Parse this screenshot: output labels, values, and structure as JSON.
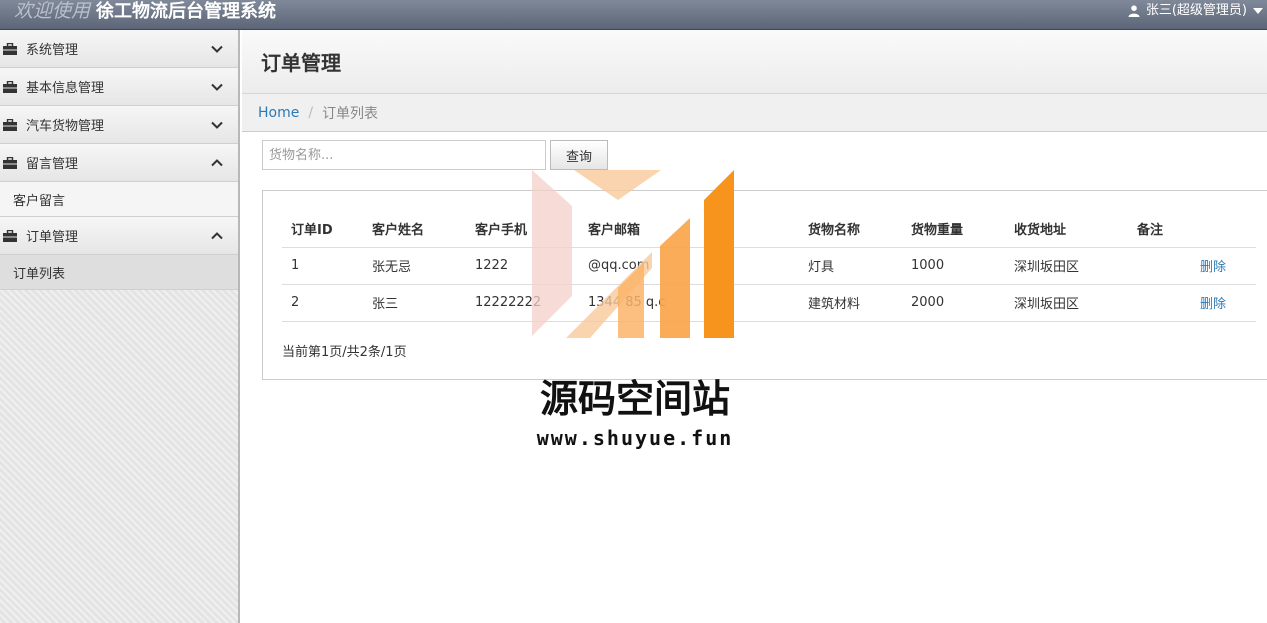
{
  "header": {
    "welcome": "欢迎使用",
    "system_name": "徐工物流后台管理系统",
    "user_label": "张三(超级管理员)"
  },
  "sidebar": {
    "menus": [
      {
        "label": "系统管理",
        "expanded": false
      },
      {
        "label": "基本信息管理",
        "expanded": false
      },
      {
        "label": "汽车货物管理",
        "expanded": false
      },
      {
        "label": "留言管理",
        "expanded": true,
        "sub": [
          "客户留言"
        ]
      },
      {
        "label": "订单管理",
        "expanded": true,
        "sub": [
          "订单列表"
        ]
      }
    ]
  },
  "page": {
    "title": "订单管理",
    "breadcrumb": {
      "home": "Home",
      "separator": "/",
      "current": "订单列表"
    }
  },
  "search": {
    "placeholder": "货物名称...",
    "button_label": "查询"
  },
  "table": {
    "columns": [
      "订单ID",
      "客户姓名",
      "客户手机",
      "客户邮箱",
      "货物名称",
      "货物重量",
      "收货地址",
      "备注"
    ],
    "rows": [
      {
        "id": "1",
        "name": "张无忌",
        "phone": "1222",
        "email": "@qq.com",
        "goods": "灯具",
        "weight": "1000",
        "address": "深圳坂田区",
        "note": "",
        "action": "删除"
      },
      {
        "id": "2",
        "name": "张三",
        "phone": "12222222",
        "email": "1344 85 q.c",
        "goods": "建筑材料",
        "weight": "2000",
        "address": "深圳坂田区",
        "note": "",
        "action": "删除"
      }
    ],
    "pagination": "当前第1页/共2条/1页"
  },
  "watermark": {
    "title": "源码空间站",
    "url": "www.shuyue.fun"
  },
  "colors": {
    "topbar": "#6b7486",
    "link": "#2a7ab8",
    "logo_orange": "#f7941d",
    "logo_pink": "#f4cfc8"
  }
}
